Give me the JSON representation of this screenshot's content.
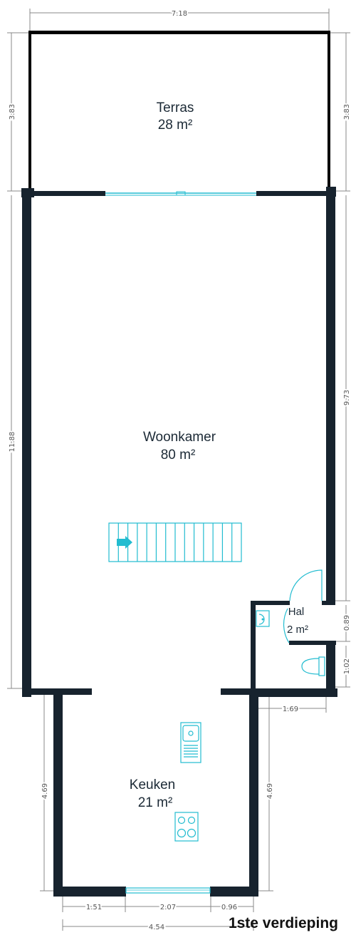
{
  "rooms": {
    "terras": {
      "name": "Terras",
      "area": "28 m²"
    },
    "woonkamer": {
      "name": "Woonkamer",
      "area": "80 m²"
    },
    "hal": {
      "name": "Hal",
      "area": "2 m²"
    },
    "keuken": {
      "name": "Keuken",
      "area": "21 m²"
    }
  },
  "dimensions": {
    "top_width": "7.18",
    "terras_left": "3.83",
    "terras_right": "3.83",
    "woonkamer_left": "11.88",
    "woonkamer_right": "9.73",
    "hal_right": "0.89",
    "toilet_right": "1.02",
    "hal_width": "1.69",
    "keuken_left": "4.69",
    "keuken_right": "4.69",
    "bottom_a": "1.51",
    "bottom_b": "2.07",
    "bottom_c": "0.96",
    "bottom_total": "4.54"
  },
  "floor_title": "1ste verdieping",
  "colors": {
    "wall": "#17232e",
    "fixture": "#22bcd0",
    "dimension": "#888888"
  }
}
